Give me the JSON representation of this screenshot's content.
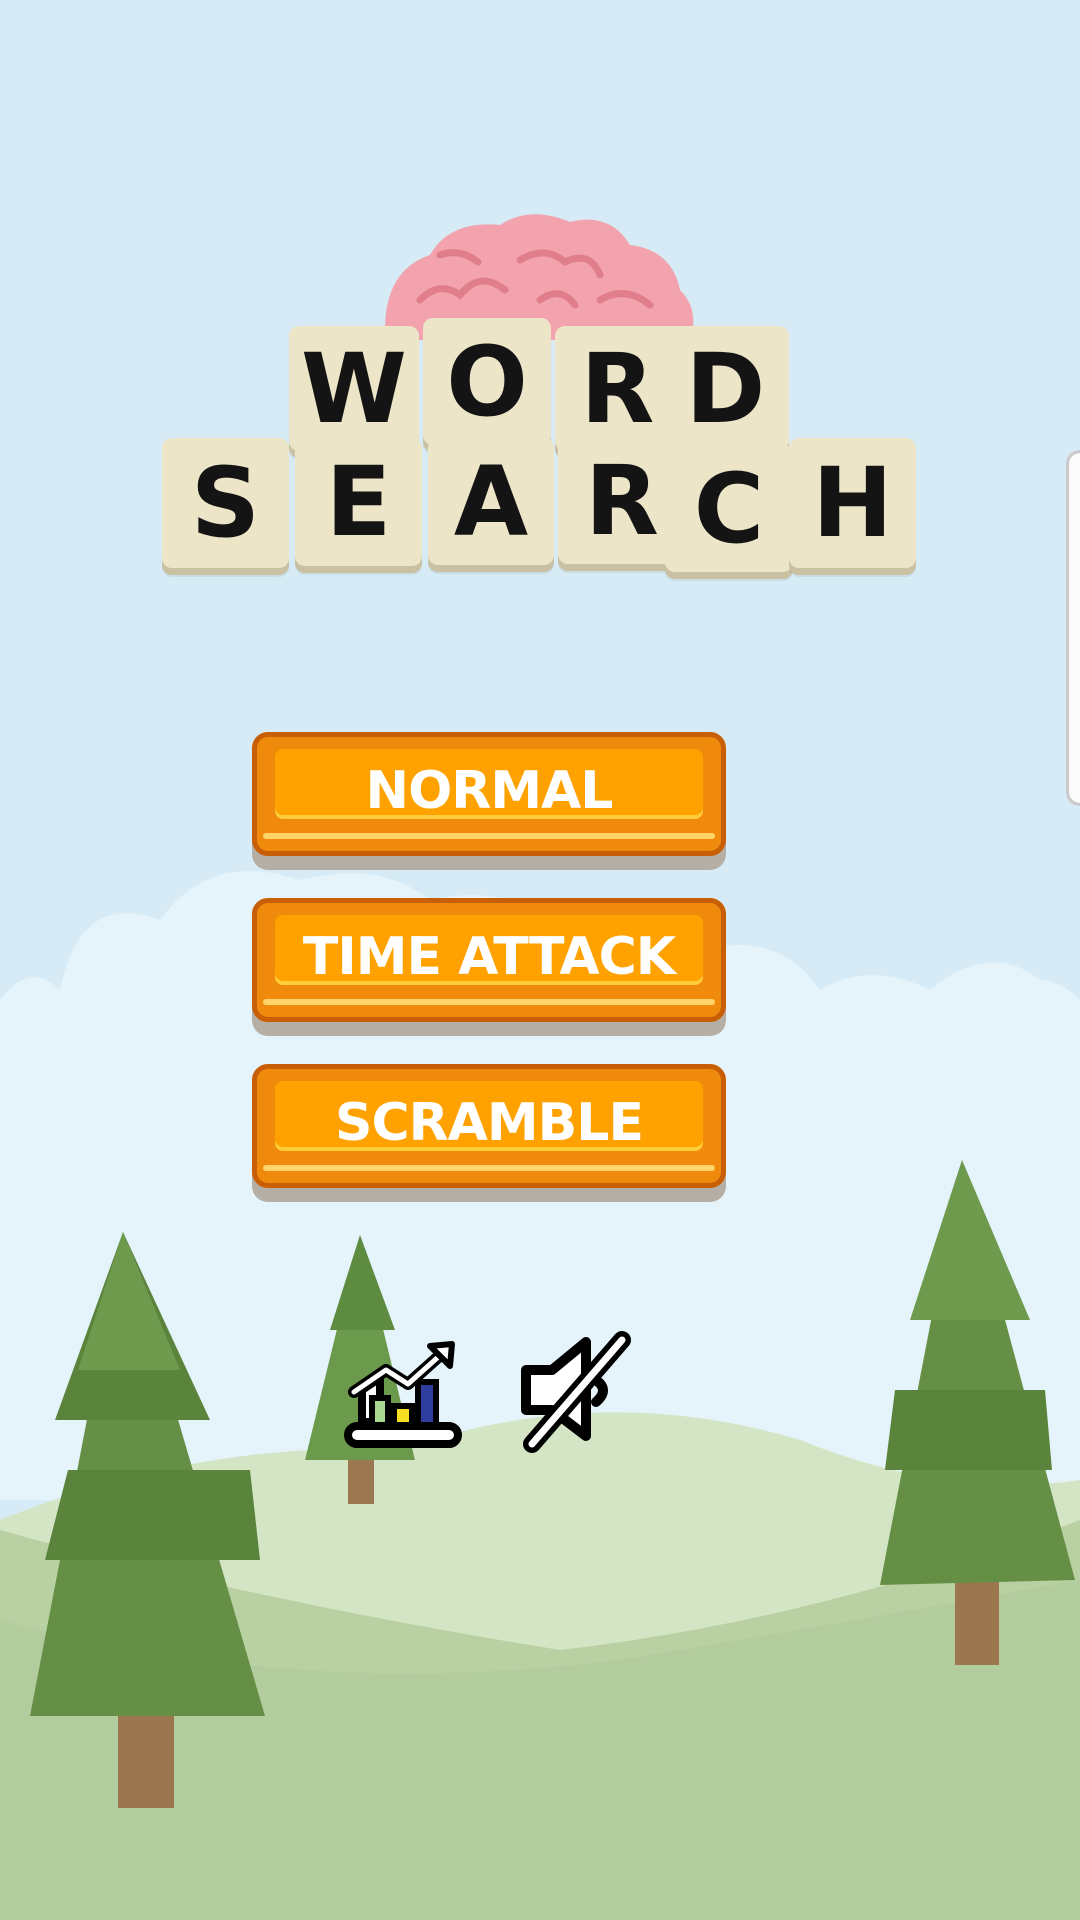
{
  "logo": {
    "line1": [
      "W",
      "O",
      "R",
      "D"
    ],
    "line2": [
      "S",
      "E",
      "A",
      "R",
      "C",
      "H"
    ]
  },
  "menu": {
    "normal_label": "NORMAL",
    "time_attack_label": "TIME ATTACK",
    "scramble_label": "SCRAMBLE"
  },
  "icons": {
    "stats": "stats-chart-icon",
    "sound": "sound-muted-icon",
    "brain": "brain-icon"
  },
  "colors": {
    "sky": "#d6ebf5",
    "button_orange": "#ffa200",
    "tile": "#ece5c8",
    "tree_green": "#658f45"
  }
}
